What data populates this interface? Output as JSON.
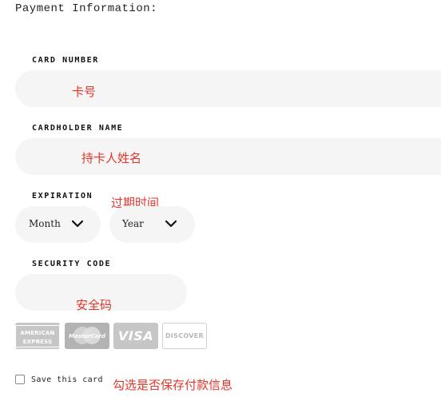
{
  "form": {
    "title": "Payment Information:",
    "card_number": {
      "label": "CARD NUMBER",
      "value": "",
      "note": "卡号"
    },
    "cardholder_name": {
      "label": "CARDHOLDER NAME",
      "value": "",
      "note": "持卡人姓名"
    },
    "expiration": {
      "label": "EXPIRATION",
      "note": "过期时间",
      "month": {
        "value": "Month"
      },
      "year": {
        "value": "Year"
      }
    },
    "security_code": {
      "label": "SECURITY CODE",
      "value": "",
      "note": "安全码"
    },
    "cards": [
      {
        "name": "American Express",
        "text": "AMERICAN EXPRESS",
        "icon": "amex-card-icon"
      },
      {
        "name": "MasterCard",
        "text": "MasterCard",
        "icon": "mastercard-card-icon"
      },
      {
        "name": "Visa",
        "text": "VISA",
        "icon": "visa-card-icon"
      },
      {
        "name": "Discover",
        "text": "DISCOVER",
        "icon": "discover-card-icon"
      }
    ],
    "save_card": {
      "label": "Save this card",
      "checked": false,
      "note": "勾选是否保存付款信息"
    }
  },
  "colors": {
    "field_bg": "#f5f5f5",
    "annotation": "#e4352b",
    "card_gray": "#c6c6c6",
    "card_dark": "#b3b3b3"
  }
}
